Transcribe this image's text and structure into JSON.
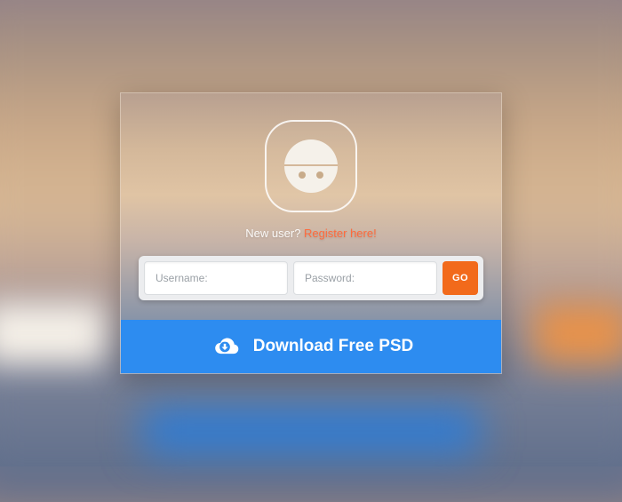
{
  "register": {
    "prompt": "New user? ",
    "link_label": "Register here!"
  },
  "form": {
    "username_placeholder": "Username:",
    "password_placeholder": "Password:",
    "submit_label": "GO"
  },
  "download": {
    "label": "Download Free PSD"
  },
  "colors": {
    "accent_orange": "#f26a1b",
    "accent_blue": "#2d8cf0"
  }
}
